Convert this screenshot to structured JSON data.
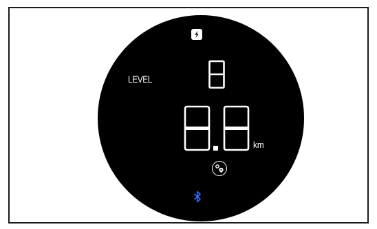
{
  "display": {
    "icons": {
      "top": "lightning-bolt-icon",
      "trip": "location-pin-icon",
      "connectivity": "bluetooth-icon"
    },
    "level": {
      "label": "LEVEL",
      "value": "8"
    },
    "distance": {
      "value": "8.8",
      "unit": "km"
    },
    "colors": {
      "background": "#000000",
      "text": "#ffffff",
      "bluetooth": "#2f6fff"
    }
  }
}
